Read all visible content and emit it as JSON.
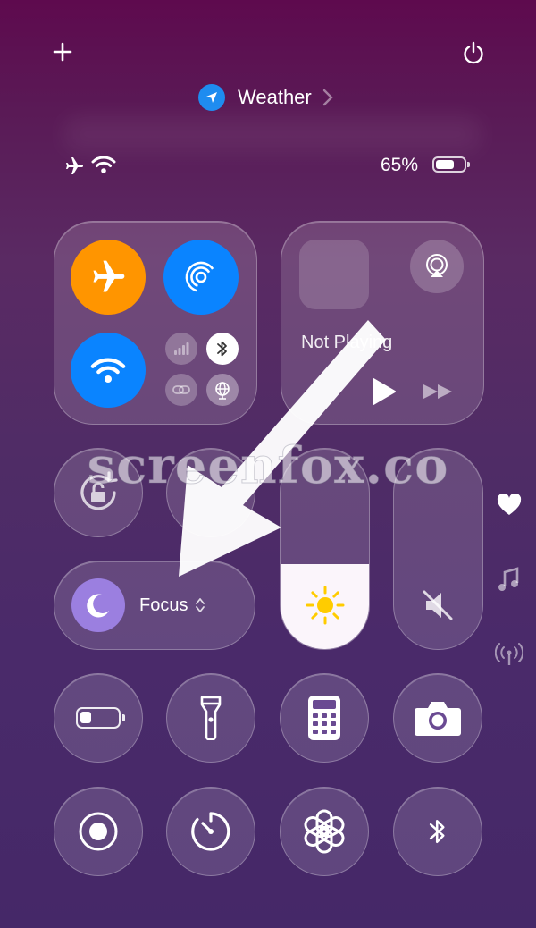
{
  "header": {
    "add_icon": "plus-icon",
    "power_icon": "power-icon",
    "location_label": "Weather"
  },
  "status_bar": {
    "battery_percent": "65%",
    "battery_level": 0.65,
    "icons": [
      "airplane-icon",
      "wifi-icon",
      "battery-icon"
    ]
  },
  "connectivity": {
    "airplane": {
      "on": true,
      "color": "#ff9500"
    },
    "airdrop": {
      "on": true,
      "color": "#0a84ff"
    },
    "wifi": {
      "on": true,
      "color": "#0a84ff"
    },
    "cellular": {
      "on": false
    },
    "bluetooth": {
      "on": true
    },
    "vpn": {
      "on": false
    },
    "personal_hotspot": {
      "on": false
    }
  },
  "media": {
    "now_playing": "Not Playing"
  },
  "focus": {
    "label": "Focus"
  },
  "sliders": {
    "brightness_level": 0.42,
    "volume_muted": true
  },
  "side_icons": [
    "heart-icon",
    "music-note-icon",
    "antenna-icon"
  ],
  "controls_row1": [
    "low-power-battery-icon",
    "flashlight-icon",
    "calculator-icon",
    "camera-icon"
  ],
  "controls_row2": [
    "screen-record-icon",
    "timer-icon",
    "chatgpt-icon",
    "bluetooth-icon"
  ],
  "watermark": "screenfox.co"
}
